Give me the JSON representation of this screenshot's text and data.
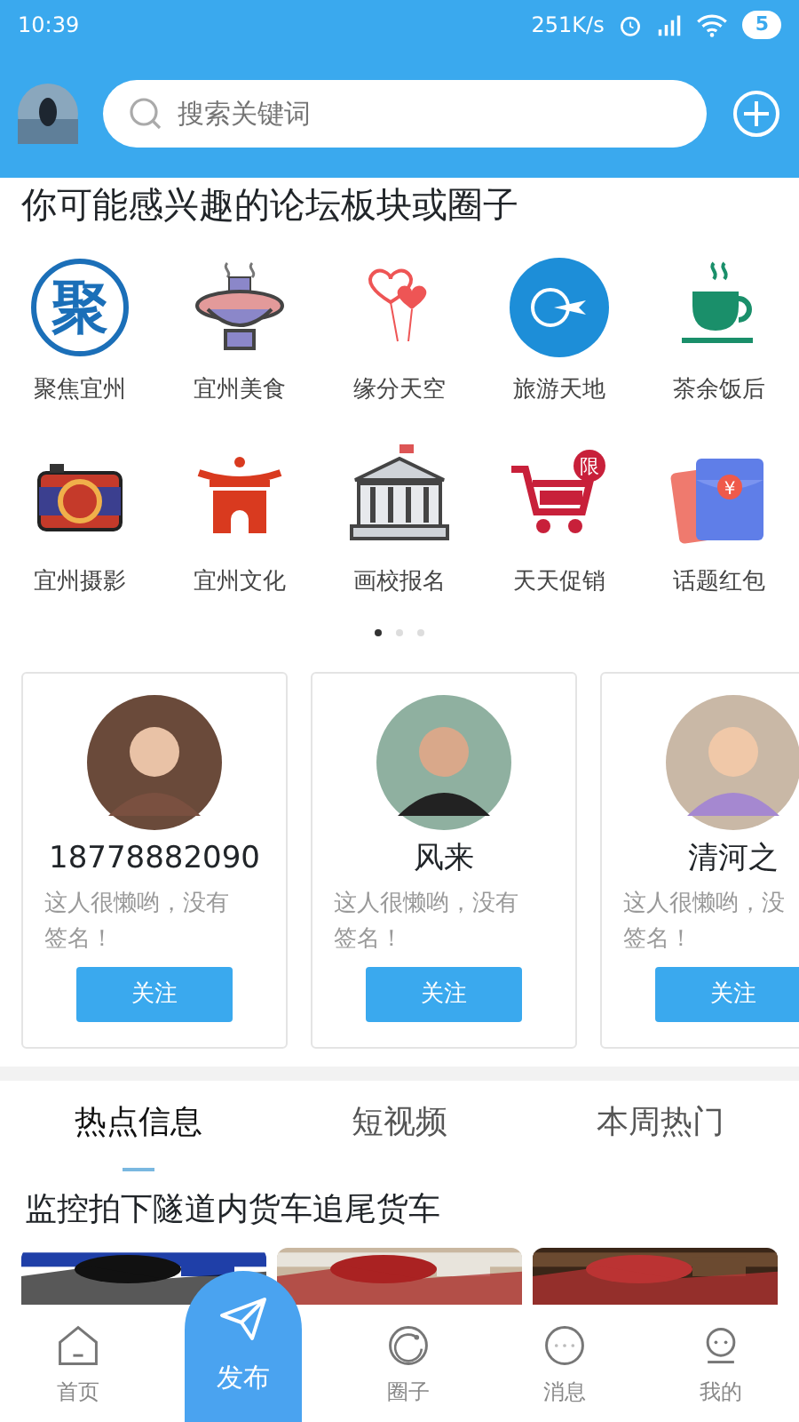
{
  "status_bar": {
    "time": "10:39",
    "speed": "251K/s",
    "battery": "5"
  },
  "header": {
    "search_placeholder": "搜索关键词"
  },
  "section_title": "你可能感兴趣的论坛板块或圈子",
  "forums": [
    {
      "label": "聚焦宜州",
      "icon_text": "聚"
    },
    {
      "label": "宜州美食"
    },
    {
      "label": "缘分天空"
    },
    {
      "label": "旅游天地"
    },
    {
      "label": "茶余饭后"
    },
    {
      "label": "宜州摄影"
    },
    {
      "label": "宜州文化"
    },
    {
      "label": "画校报名"
    },
    {
      "label": "天天促销",
      "icon_text": "限"
    },
    {
      "label": "话题红包",
      "icon_text": "¥"
    }
  ],
  "pager": [
    {
      "selected": true
    },
    {
      "selected": false
    },
    {
      "selected": false
    }
  ],
  "users": [
    {
      "name": "18778882090",
      "bio": [
        "这人很懒哟，没有",
        "签名！"
      ],
      "button": "关注"
    },
    {
      "name": "风来",
      "bio": [
        "这人很懒哟，没有",
        "签名！"
      ],
      "button": "关注"
    },
    {
      "name": "清河之",
      "bio": [
        "这人很懒哟，没",
        "签名！"
      ],
      "button": "关注"
    }
  ],
  "tabs": [
    {
      "label": "热点信息",
      "selected": true
    },
    {
      "label": "短视频",
      "selected": false
    },
    {
      "label": "本周热门",
      "selected": false
    }
  ],
  "headline": "监控拍下隧道内货车追尾货车",
  "bottom_nav": [
    {
      "label": "首页",
      "kind": "tab"
    },
    {
      "label": "发布",
      "kind": "publish"
    },
    {
      "label": "圈子",
      "kind": "tab"
    },
    {
      "label": "消息",
      "kind": "tab"
    },
    {
      "label": "我的",
      "kind": "tab"
    }
  ]
}
